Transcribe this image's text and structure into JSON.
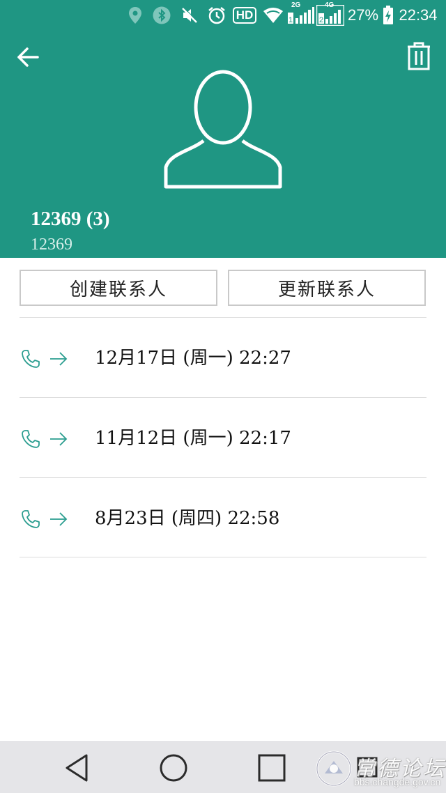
{
  "colors": {
    "accent": "#1f9683",
    "accent_icon": "#2a9d8f",
    "divider": "#dcdcdc",
    "nav_bg": "#e5e5e8"
  },
  "status_bar": {
    "icons": [
      "location-icon",
      "bluetooth-icon",
      "mute-icon",
      "alarm-icon",
      "hd-icon",
      "wifi-icon",
      "signal-2g-icon",
      "signal-4g-icon",
      "battery-icon"
    ],
    "hd_label": "HD",
    "sim1_label": "2G",
    "sim2_label": "4G",
    "battery_percent": "27%",
    "time": "22:34"
  },
  "header": {
    "contact_name": "12369 (3)",
    "contact_number": "12369"
  },
  "actions": {
    "create_label": "创建联系人",
    "update_label": "更新联系人"
  },
  "call_log": [
    {
      "type": "outgoing",
      "time": "12月17日 (周一) 22:27"
    },
    {
      "type": "outgoing",
      "time": "11月12日 (周一) 22:17"
    },
    {
      "type": "outgoing",
      "time": "8月23日 (周四) 22:58"
    }
  ],
  "watermark": {
    "title": "常德论坛",
    "url": "bbs.changde.gov.cn"
  }
}
